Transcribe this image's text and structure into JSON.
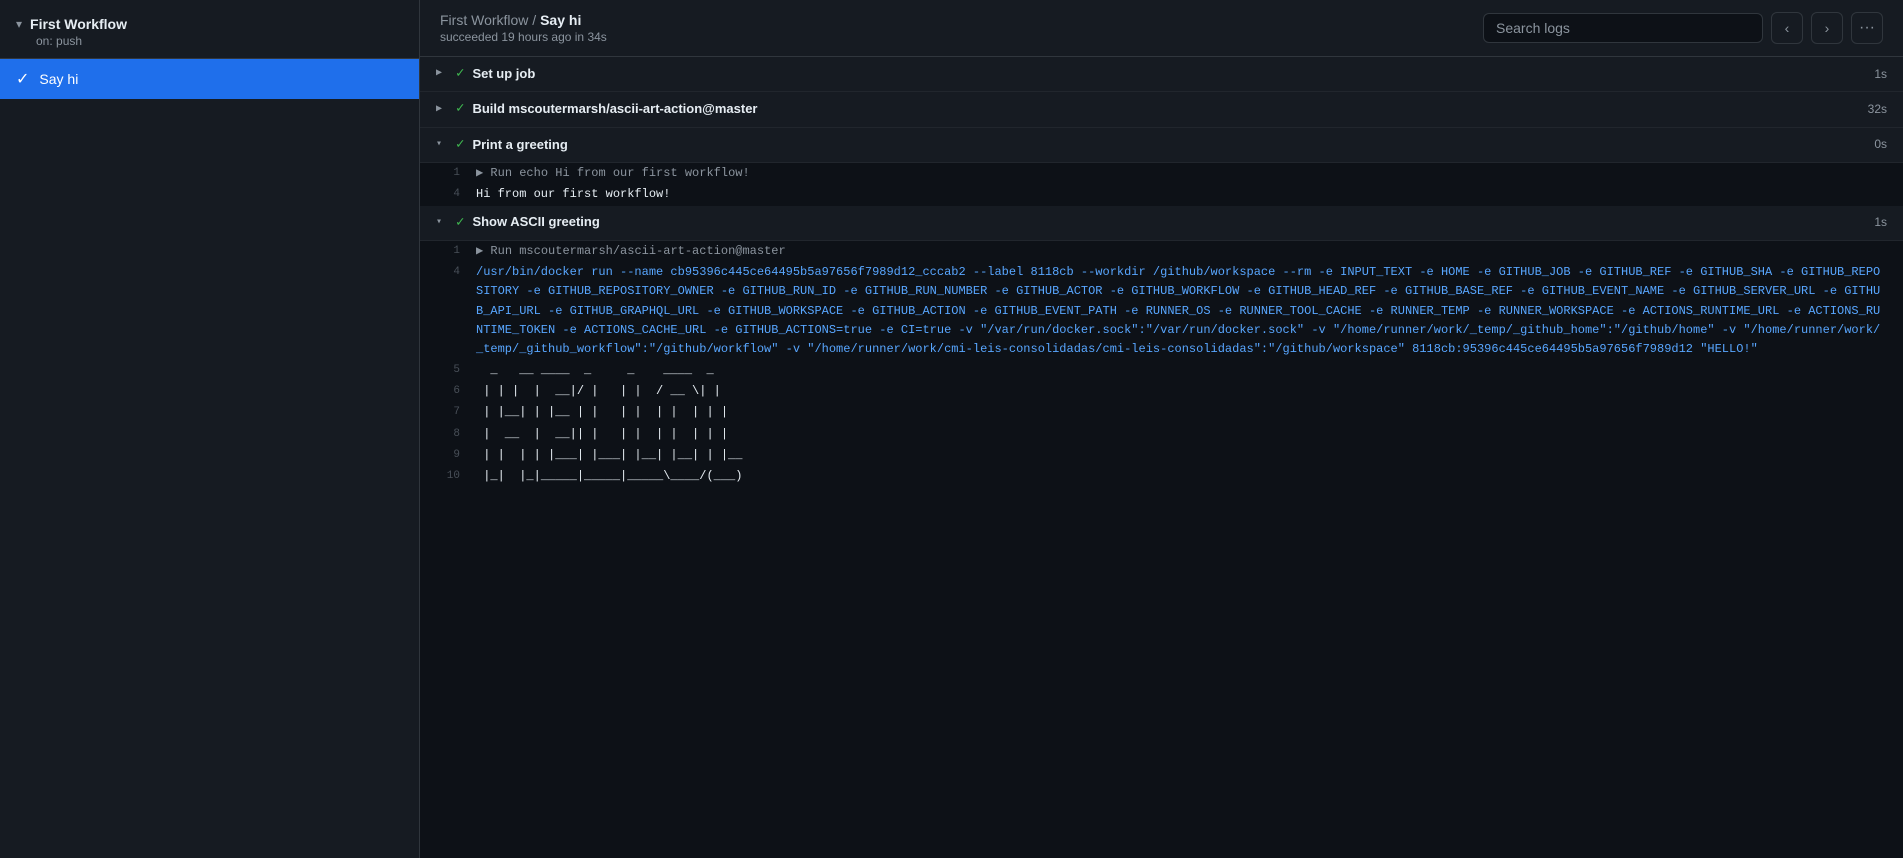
{
  "sidebar": {
    "workflow_name": "First Workflow",
    "workflow_trigger": "on: push",
    "chevron": "▾",
    "jobs": [
      {
        "id": "say-hi",
        "label": "Say hi",
        "active": true,
        "status": "success"
      }
    ]
  },
  "topbar": {
    "breadcrumb_workflow": "First Workflow",
    "breadcrumb_separator": " / ",
    "breadcrumb_job": "Say hi",
    "subtitle": "succeeded 19 hours ago in 34s",
    "search_placeholder": "Search logs",
    "prev_label": "‹",
    "next_label": "›",
    "more_label": "···"
  },
  "steps": [
    {
      "id": "setup-job",
      "name": "Set up job",
      "status": "success",
      "expanded": false,
      "duration": "1s",
      "toggle": "▶"
    },
    {
      "id": "build",
      "name": "Build mscoutermarsh/ascii-art-action@master",
      "status": "success",
      "expanded": false,
      "duration": "32s",
      "toggle": "▶"
    },
    {
      "id": "print-greeting",
      "name": "Print a greeting",
      "status": "success",
      "expanded": true,
      "duration": "0s",
      "toggle": "▾",
      "lines": [
        {
          "num": "1",
          "type": "run-cmd",
          "content": "▶ Run echo Hi from our first workflow!"
        },
        {
          "num": "4",
          "type": "normal",
          "content": "Hi from our first workflow!"
        }
      ]
    },
    {
      "id": "show-ascii",
      "name": "Show ASCII greeting",
      "status": "success",
      "expanded": true,
      "duration": "1s",
      "toggle": "▾",
      "lines": [
        {
          "num": "1",
          "type": "run-cmd",
          "content": "▶ Run mscoutermarsh/ascii-art-action@master"
        },
        {
          "num": "4",
          "type": "cmd",
          "content": "/usr/bin/docker run --name cb95396c445ce64495b5a97656f7989d12_cccab2 --label 8118cb --workdir /github/workspace --rm -e INPUT_TEXT -e HOME -e GITHUB_JOB -e GITHUB_REF -e GITHUB_SHA -e GITHUB_REPOSITORY -e GITHUB_REPOSITORY_OWNER -e GITHUB_RUN_ID -e GITHUB_RUN_NUMBER -e GITHUB_ACTOR -e GITHUB_WORKFLOW -e GITHUB_HEAD_REF -e GITHUB_BASE_REF -e GITHUB_EVENT_NAME -e GITHUB_SERVER_URL -e GITHUB_API_URL -e GITHUB_GRAPHQL_URL -e GITHUB_WORKSPACE -e GITHUB_ACTION -e GITHUB_EVENT_PATH -e RUNNER_OS -e RUNNER_TOOL_CACHE -e RUNNER_TEMP -e RUNNER_WORKSPACE -e ACTIONS_RUNTIME_URL -e ACTIONS_RUNTIME_TOKEN -e ACTIONS_CACHE_URL -e GITHUB_ACTIONS=true -e CI=true -v \"/var/run/docker.sock\":\"/var/run/docker.sock\" -v \"/home/runner/work/_temp/_github_home\":\"/github/home\" -v \"/home/runner/work/_temp/_github_workflow\":\"/github/workflow\" -v \"/home/runner/work/cmi-leis-consolidadas/cmi-leis-consolidadas\":\"/github/workspace\" 8118cb:95396c445ce64495b5a97656f7989d12 \"HELLO!\""
        },
        {
          "num": "5",
          "type": "ascii",
          "content": "  _   __ ____  _     _    ____  _"
        },
        {
          "num": "6",
          "type": "ascii",
          "content": " | | |  |  __|/ |   | |  / __ \\| |"
        },
        {
          "num": "7",
          "type": "ascii",
          "content": " | |__| | |__ | |   | |  | |  | | |"
        },
        {
          "num": "8",
          "type": "ascii",
          "content": " |  __  |  __|| |   | |  | |  | | |"
        },
        {
          "num": "9",
          "type": "ascii",
          "content": " | |  | | |___| |___| |__| |__| | |__"
        },
        {
          "num": "10",
          "type": "ascii",
          "content": " |_|  |_|_____|_____|_____\\____/(___)"
        }
      ]
    }
  ]
}
